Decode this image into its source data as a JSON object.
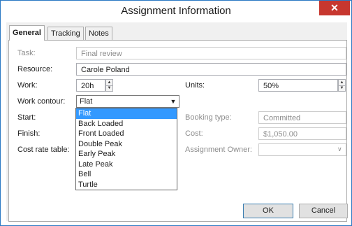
{
  "window": {
    "title": "Assignment Information",
    "close_glyph": "✕"
  },
  "tabs": [
    {
      "label": "General",
      "active": true
    },
    {
      "label": "Tracking",
      "active": false
    },
    {
      "label": "Notes",
      "active": false
    }
  ],
  "fields": {
    "task": {
      "label": "Task:",
      "value": "Final review",
      "enabled": false
    },
    "resource": {
      "label": "Resource:",
      "value": "Carole Poland"
    },
    "work": {
      "label": "Work:",
      "value": "20h"
    },
    "units": {
      "label": "Units:",
      "value": "50%"
    },
    "work_contour": {
      "label": "Work contour:",
      "value": "Flat"
    },
    "start": {
      "label": "Start:"
    },
    "finish": {
      "label": "Finish:"
    },
    "cost_rate_table": {
      "label": "Cost rate table:"
    },
    "booking_type": {
      "label": "Booking type:",
      "value": "Committed",
      "enabled": false
    },
    "cost": {
      "label": "Cost:",
      "value": "$1,050.00",
      "enabled": false
    },
    "assignment_owner": {
      "label": "Assignment Owner:",
      "value": "",
      "enabled": false
    }
  },
  "contour_options": [
    "Flat",
    "Back Loaded",
    "Front Loaded",
    "Double Peak",
    "Early Peak",
    "Late Peak",
    "Bell",
    "Turtle"
  ],
  "contour_selected": "Flat",
  "buttons": {
    "ok": "OK",
    "cancel": "Cancel"
  },
  "colors": {
    "titlebar_border": "#2b79c4",
    "close_button": "#c7372f",
    "selection": "#3399ff"
  },
  "icons": {
    "close": "close-icon",
    "combo_arrow": "chevron-down-icon",
    "spin": "spin-arrows-icon"
  }
}
